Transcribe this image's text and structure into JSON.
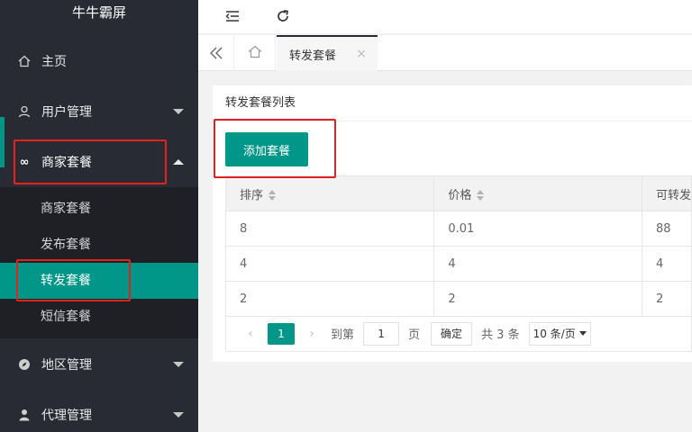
{
  "app": {
    "title": "牛牛霸屏"
  },
  "sidebar": {
    "items": [
      {
        "label": "主页",
        "icon": "home-icon"
      },
      {
        "label": "用户管理",
        "icon": "user-icon"
      },
      {
        "label": "商家套餐",
        "icon": "infinity-icon"
      },
      {
        "label": "地区管理",
        "icon": "compass-icon"
      },
      {
        "label": "代理管理",
        "icon": "person-icon"
      }
    ],
    "sub_items": [
      {
        "label": "商家套餐"
      },
      {
        "label": "发布套餐"
      },
      {
        "label": "转发套餐"
      },
      {
        "label": "短信套餐"
      }
    ]
  },
  "tabs": {
    "active_label": "转发套餐"
  },
  "card": {
    "title": "转发套餐列表",
    "add_button": "添加套餐"
  },
  "table": {
    "columns": [
      "排序",
      "价格",
      "可转发"
    ],
    "rows": [
      [
        "8",
        "0.01",
        "88"
      ],
      [
        "4",
        "4",
        "4"
      ],
      [
        "2",
        "2",
        "2"
      ]
    ]
  },
  "pager": {
    "current_page": "1",
    "goto_label": "到第",
    "goto_value": "1",
    "page_unit": "页",
    "confirm_label": "确定",
    "total": "共 3 条",
    "per_page": "10 条/页"
  },
  "colors": {
    "accent": "#009688",
    "sidebar_bg": "#282b33",
    "highlight": "#e3231b"
  }
}
